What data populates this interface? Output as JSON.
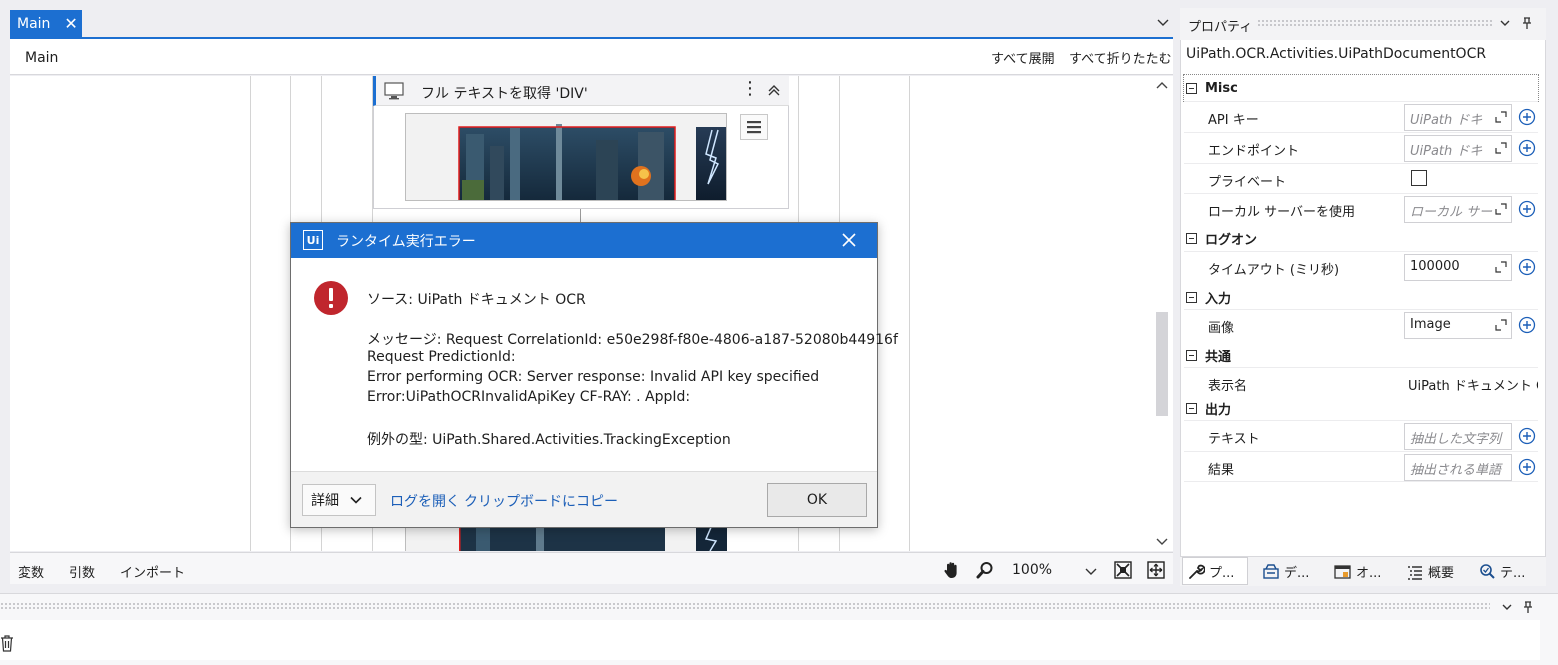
{
  "doc_tab": {
    "label": "Main"
  },
  "breadcrumb": "Main",
  "designer_actions": {
    "expand_all": "すべて展開",
    "collapse_all": "すべて折りたたむ"
  },
  "activity": {
    "title": "フル テキストを取得 'DIV'"
  },
  "bottom_tabs": {
    "variables": "変数",
    "arguments": "引数",
    "imports": "インポート"
  },
  "zoom": {
    "value": "100%"
  },
  "properties": {
    "title": "プロパティ",
    "type_name": "UiPath.OCR.Activities.UiPathDocumentOCR",
    "categories": [
      {
        "name": "Misc",
        "rows": [
          {
            "label": "API キー",
            "value": "UiPath ドキ"
          },
          {
            "label": "エンドポイント",
            "value": "UiPath ドキ"
          },
          {
            "label": "プライベート",
            "checked": false
          },
          {
            "label": "ローカル サーバーを使用",
            "value": "ローカル サー"
          }
        ]
      },
      {
        "name": "ログオン",
        "rows": [
          {
            "label": "タイムアウト (ミリ秒)",
            "value": "100000"
          }
        ]
      },
      {
        "name": "入力",
        "rows": [
          {
            "label": "画像",
            "value": "Image"
          }
        ]
      },
      {
        "name": "共通",
        "rows": [
          {
            "label": "表示名",
            "value": "UiPath ドキュメント OC"
          }
        ]
      },
      {
        "name": "出力",
        "rows": [
          {
            "label": "テキスト",
            "value": "抽出した文字列"
          },
          {
            "label": "結果",
            "value": "抽出される単語"
          }
        ]
      }
    ],
    "tabs": [
      "プ...",
      "デ...",
      "オ...",
      "概要",
      "テ..."
    ]
  },
  "dialog": {
    "logo": "Ui",
    "title": "ランタイム実行エラー",
    "source": "ソース: UiPath ドキュメント OCR",
    "message_lines": [
      "メッセージ: Request CorrelationId: e50e298f-f80e-4806-a187-52080b44916f",
      "Request PredictionId:",
      "Error performing OCR: Server response: Invalid API key specified",
      "Error:UiPathOCRInvalidApiKey CF-RAY: . AppId:"
    ],
    "exception_type": "例外の型: UiPath.Shared.Activities.TrackingException",
    "details_label": "詳細",
    "open_log": "ログを開く",
    "copy_clipboard": "クリップボードにコピー",
    "ok": "OK"
  },
  "colors": {
    "accent": "#1c6fd1",
    "error": "#c0262d"
  }
}
